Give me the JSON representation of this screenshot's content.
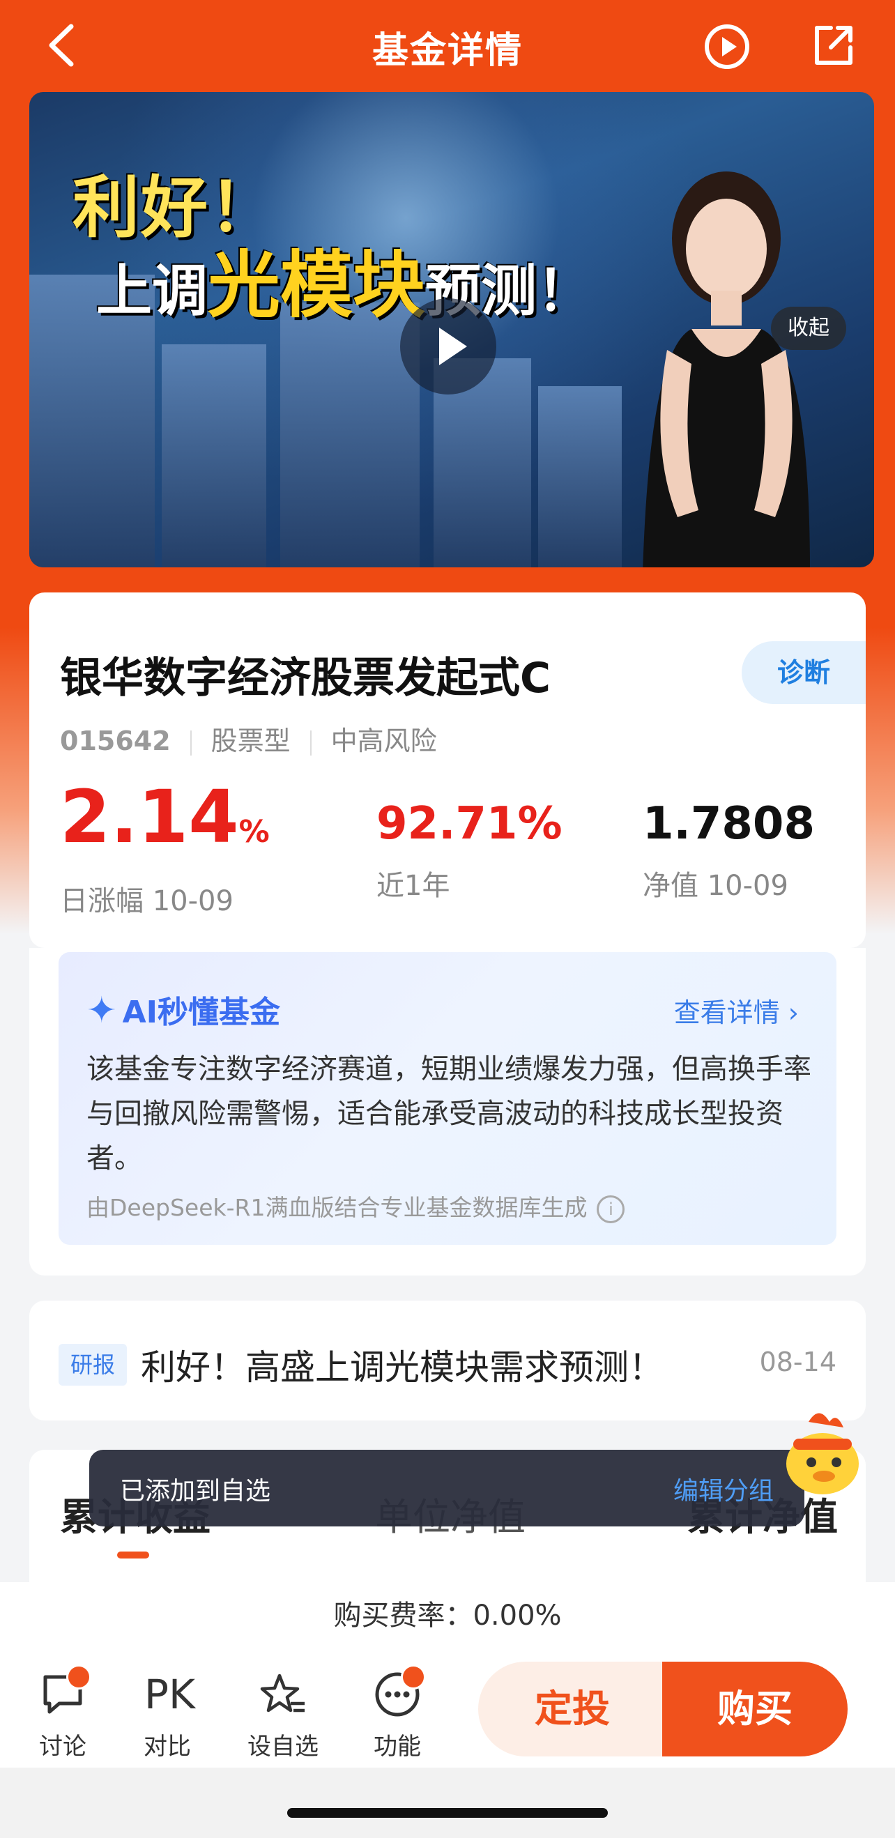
{
  "colors": {
    "brand": "#ef4a12",
    "up": "#e8221b",
    "link": "#3a7ce8"
  },
  "nav": {
    "title": "基金详情",
    "icons": {
      "back": "chevron-left-icon",
      "play": "play-circle-icon",
      "share": "share-icon"
    }
  },
  "video": {
    "headline_line1": "利好！",
    "headline_line2_pre": "上调",
    "headline_line2_highlight": "光模块",
    "headline_line2_post": "预测！",
    "collapse_label": "收起"
  },
  "fund": {
    "name": "银华数字经济股票发起式C",
    "diagnose_label": "诊断",
    "code": "015642",
    "type": "股票型",
    "risk": "中高风险",
    "stats": [
      {
        "value": "2.14",
        "unit": "%",
        "label": "日涨幅 10-09"
      },
      {
        "value": "92.71%",
        "label": "近1年"
      },
      {
        "value": "1.7808",
        "label": "净值 10-09"
      }
    ]
  },
  "ai": {
    "title": "AI秒懂基金",
    "more_label": "查看详情",
    "summary": "该基金专注数字经济赛道，短期业绩爆发力强，但高换手率与回撤风险需警惕，适合能承受高波动的科技成长型投资者。",
    "footnote": "由DeepSeek-R1满血版结合专业基金数据库生成"
  },
  "research": {
    "tag": "研报",
    "title": "利好！高盛上调光模块需求预测！",
    "date": "08-14"
  },
  "tabs": [
    "累计收益",
    "单位净值",
    "累计净值"
  ],
  "toast": {
    "text": "已添加到自选",
    "action": "编辑分组"
  },
  "fee": {
    "text": "购买费率：0.00%"
  },
  "bottom_bar": {
    "items": [
      {
        "label": "讨论",
        "icon": "chat-icon",
        "badge": true
      },
      {
        "label": "对比",
        "icon": "pk-icon",
        "icon_text": "PK",
        "badge": false
      },
      {
        "label": "设自选",
        "icon": "star-list-icon",
        "badge": false
      },
      {
        "label": "功能",
        "icon": "more-icon",
        "badge": true
      }
    ],
    "sip_label": "定投",
    "buy_label": "购买"
  }
}
